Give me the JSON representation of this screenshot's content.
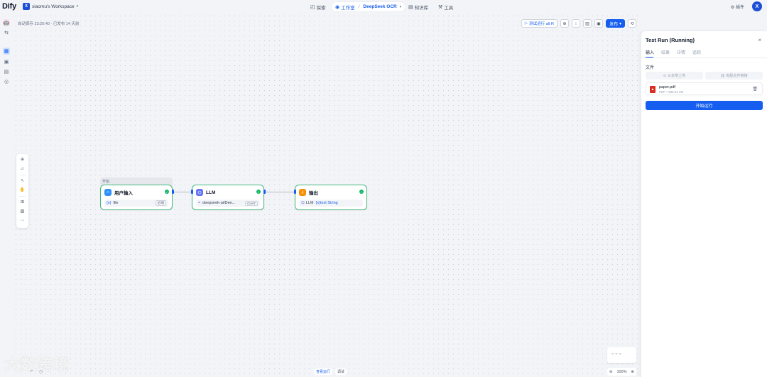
{
  "header": {
    "logo": "Dify",
    "workspace_initial": "X",
    "workspace_name": "xiaomu's Workspace",
    "nav": [
      {
        "label": "探索",
        "icon": "explore-icon"
      },
      {
        "label": "工作室",
        "icon": "studio-icon"
      },
      {
        "label": "知识库",
        "icon": "knowledge-icon"
      },
      {
        "label": "工具",
        "icon": "tools-icon"
      }
    ],
    "current_app": "DeepSeek OCR",
    "plugins_label": "插件",
    "user_initial": "X"
  },
  "canvas": {
    "autosave": "自动保存 23:20:40 · 已发布 14 天前",
    "test_run_label": "测试运行 alt R",
    "publish_label": "发布"
  },
  "nodes": {
    "start_tag": "开始",
    "user_input": {
      "title": "用户输入",
      "var": "file",
      "badge": "必填"
    },
    "llm": {
      "title": "LLM",
      "model": "deepseek-ai/Dee...",
      "badge": "CHAT"
    },
    "output": {
      "title": "输出",
      "var": "LLM",
      "var_path": "{x}text String"
    }
  },
  "panel": {
    "title": "Test Run (Running)",
    "tabs": [
      "输入",
      "结果",
      "详情",
      "追踪"
    ],
    "file_label": "文件",
    "upload_local": "从本地上传",
    "paste_link": "粘贴文件链接",
    "file": {
      "name": "paper.pdf",
      "meta": "PDF • 685.81 KB"
    },
    "run_button": "开始运行"
  },
  "bottom": {
    "zoom": "100%",
    "latest_run": "查看运行",
    "debug": "调试",
    "watermark": "大数跨境"
  },
  "colors": {
    "accent": "#155eef",
    "node_border": "#47b881",
    "success": "#12b76a",
    "pdf": "#d92d20"
  }
}
